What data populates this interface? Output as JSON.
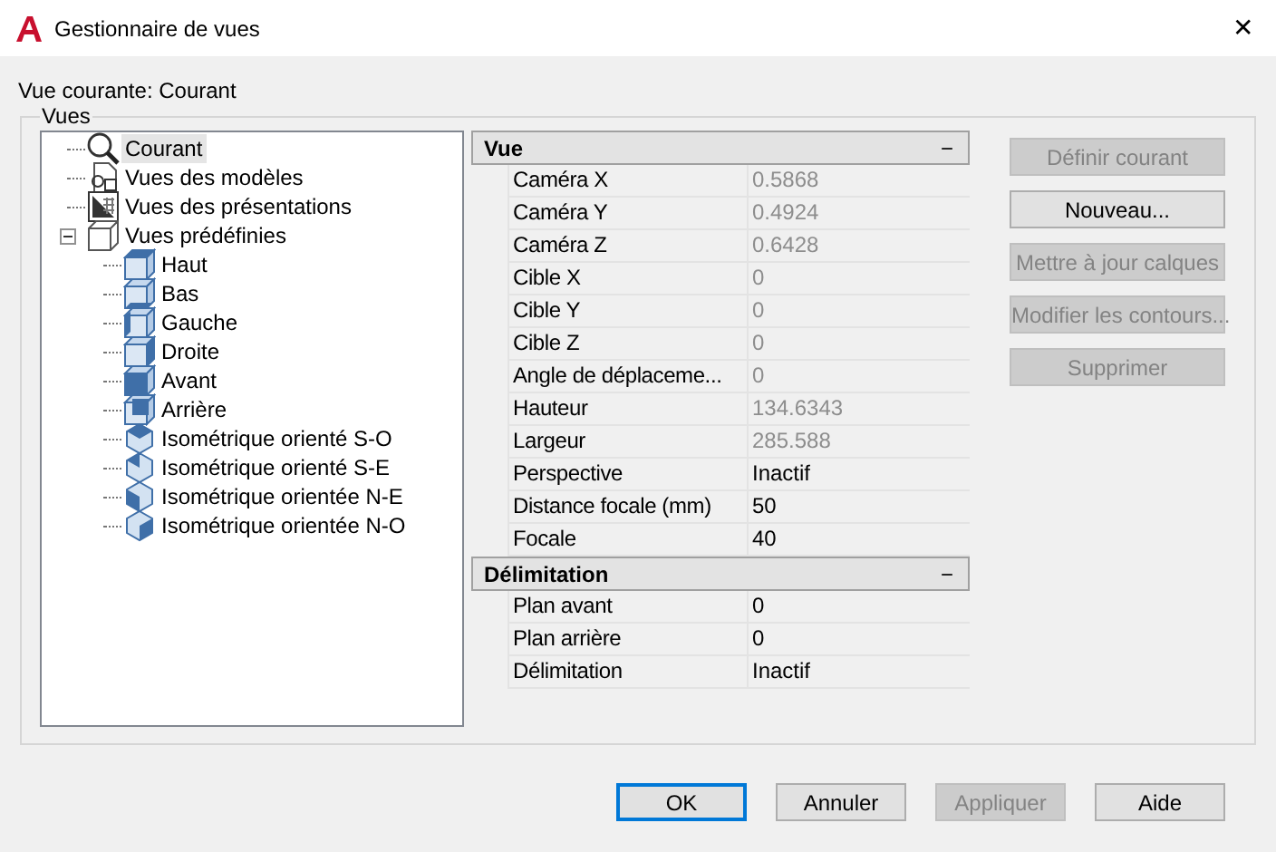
{
  "window": {
    "title": "Gestionnaire de vues",
    "close": "✕"
  },
  "current_view": "Vue courante: Courant",
  "group": {
    "label": "Vues"
  },
  "tree": [
    {
      "label": "Courant",
      "kind": "current",
      "selected": true
    },
    {
      "label": "Vues des modèles",
      "kind": "model",
      "selected": false
    },
    {
      "label": "Vues des présentations",
      "kind": "layout",
      "selected": false
    },
    {
      "label": "Vues prédéfinies",
      "kind": "preset",
      "selected": false,
      "expanded": true,
      "children": [
        {
          "label": "Haut",
          "kind": "cube",
          "selected": false
        },
        {
          "label": "Bas",
          "kind": "cube",
          "selected": false
        },
        {
          "label": "Gauche",
          "kind": "cube",
          "selected": false
        },
        {
          "label": "Droite",
          "kind": "cube",
          "selected": false
        },
        {
          "label": "Avant",
          "kind": "cube",
          "selected": false
        },
        {
          "label": "Arrière",
          "kind": "cube",
          "selected": false
        },
        {
          "label": "Isométrique orienté S-O",
          "kind": "iso",
          "selected": false
        },
        {
          "label": "Isométrique orienté S-E",
          "kind": "iso",
          "selected": false
        },
        {
          "label": "Isométrique orientée N-E",
          "kind": "iso",
          "selected": false
        },
        {
          "label": "Isométrique orientée N-O",
          "kind": "iso",
          "selected": false
        }
      ]
    }
  ],
  "properties": [
    {
      "category": "Vue",
      "toggle": "−",
      "expanded": true,
      "rows": [
        {
          "name": "Caméra X",
          "value": "0.5868",
          "disabled": true
        },
        {
          "name": "Caméra Y",
          "value": "0.4924",
          "disabled": true
        },
        {
          "name": "Caméra Z",
          "value": "0.6428",
          "disabled": true
        },
        {
          "name": "Cible X",
          "value": "0",
          "disabled": true
        },
        {
          "name": "Cible Y",
          "value": "0",
          "disabled": true
        },
        {
          "name": "Cible Z",
          "value": "0",
          "disabled": true
        },
        {
          "name": "Angle de déplaceme...",
          "value": "0",
          "disabled": true
        },
        {
          "name": "Hauteur",
          "value": "134.6343",
          "disabled": true
        },
        {
          "name": "Largeur",
          "value": "285.588",
          "disabled": true
        },
        {
          "name": "Perspective",
          "value": "Inactif",
          "disabled": false
        },
        {
          "name": "Distance focale (mm)",
          "value": "50",
          "disabled": false
        },
        {
          "name": "Focale",
          "value": "40",
          "disabled": false
        }
      ]
    },
    {
      "category": "Délimitation",
      "toggle": "−",
      "expanded": true,
      "rows": [
        {
          "name": "Plan avant",
          "value": "0",
          "disabled": false
        },
        {
          "name": "Plan arrière",
          "value": "0",
          "disabled": false
        },
        {
          "name": "Délimitation",
          "value": "Inactif",
          "disabled": false
        }
      ]
    }
  ],
  "side_buttons": [
    {
      "label": "Définir courant",
      "disabled": true
    },
    {
      "label": "Nouveau...",
      "disabled": false
    },
    {
      "label": "Mettre à jour calques",
      "disabled": true
    },
    {
      "label": "Modifier les contours...",
      "disabled": true
    },
    {
      "label": "Supprimer",
      "disabled": true
    }
  ],
  "footer_buttons": [
    {
      "label": "OK",
      "disabled": false,
      "default": true
    },
    {
      "label": "Annuler",
      "disabled": false,
      "default": false
    },
    {
      "label": "Appliquer",
      "disabled": true,
      "default": false
    },
    {
      "label": "Aide",
      "disabled": false,
      "default": false
    }
  ]
}
